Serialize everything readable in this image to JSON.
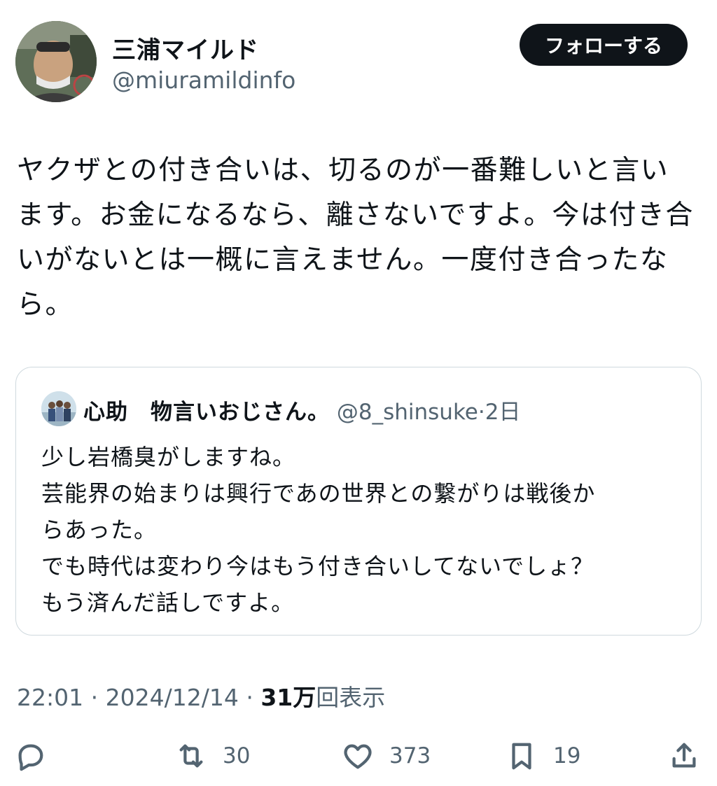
{
  "author": {
    "name": "三浦マイルド",
    "handle": "@miuramildinfo"
  },
  "follow_label": "フォローする",
  "tweet_text": "ヤクザとの付き合いは、切るのが一番難しいと言います。お金になるなら、離さないですよ。今は付き合いがないとは一概に言えません。一度付き合ったなら。",
  "quote": {
    "name": "心助　物言いおじさん。",
    "handle": "@8_shinsuke",
    "separator": "·",
    "time": "2日",
    "lines": [
      "少し岩橋臭がしますね。",
      "芸能界の始まりは興行であの世界との繋がりは戦後か",
      "らあった。",
      "でも時代は変わり今はもう付き合いしてないでしょ？",
      "もう済んだ話しですよ。"
    ]
  },
  "meta": {
    "time": "22:01",
    "sep1": "·",
    "date": "2024/12/14",
    "sep2": "·",
    "views_count": "31万",
    "views_label": "回表示"
  },
  "actions": {
    "reply_icon": "reply-icon",
    "retweet_icon": "retweet-icon",
    "retweets": "30",
    "like_icon": "heart-icon",
    "likes": "373",
    "bookmark_icon": "bookmark-icon",
    "bookmarks": "19",
    "share_icon": "share-icon"
  },
  "colors": {
    "text": "#0f1419",
    "secondary": "#536471",
    "border": "#cfd9de",
    "follow_bg": "#0f1419"
  }
}
